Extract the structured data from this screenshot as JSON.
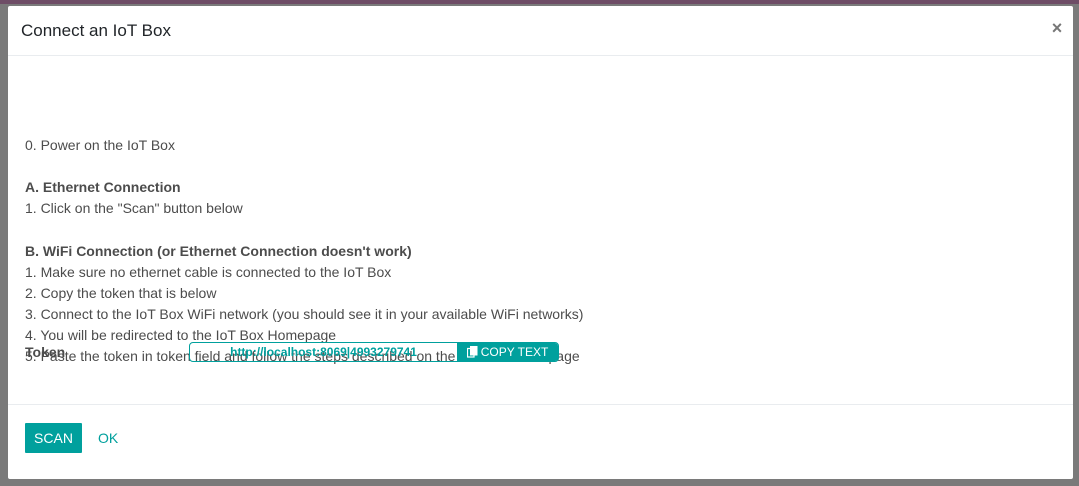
{
  "dialog": {
    "title": "Connect an IoT Box",
    "close_symbol": "×"
  },
  "body": {
    "step0": "0. Power on the IoT Box",
    "ethernet": {
      "heading": "A. Ethernet Connection",
      "steps": [
        "1. Click on the \"Scan\" button below"
      ]
    },
    "wifi": {
      "heading": "B. WiFi Connection (or Ethernet Connection doesn't work)",
      "steps": [
        "1. Make sure no ethernet cable is connected to the IoT Box",
        "2. Copy the token that is below",
        "3. Connect to the IoT Box WiFi network (you should see it in your available WiFi networks)",
        "4. You will be redirected to the IoT Box Homepage",
        "5. Paste the token in token field and follow the steps described on the IoT Box Homepage"
      ]
    },
    "token": {
      "label": "Token",
      "value": "http://localhost:8069|4993279741",
      "copy_label": "COPY TEXT",
      "copy_icon": "clipboard-icon"
    }
  },
  "footer": {
    "scan_label": "SCAN",
    "ok_label": "OK"
  },
  "colors": {
    "accent": "#00a09d",
    "text": "#4c4c4c"
  }
}
